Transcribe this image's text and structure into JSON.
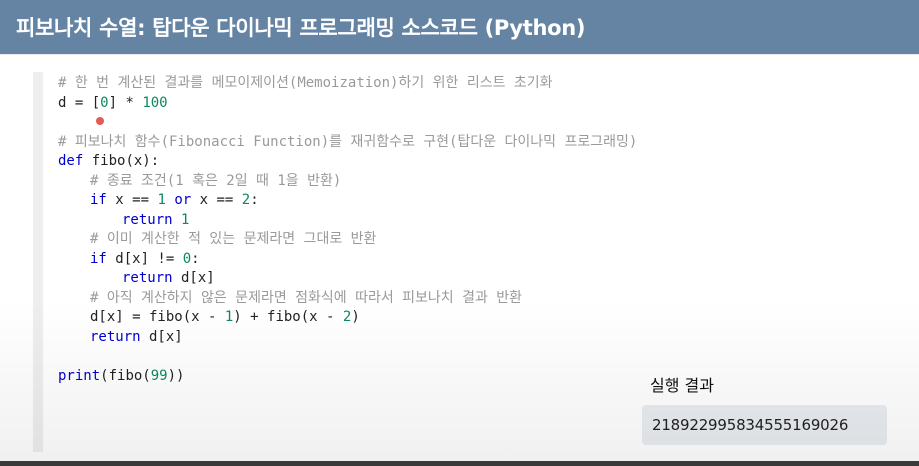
{
  "header": {
    "title": "피보나치 수열: 탑다운 다이나믹 프로그래밍 소스코드 (Python)",
    "background": "#6584a4"
  },
  "code": {
    "line1_comment": "# 한 번 계산된 결과를 메모이제이션(Memoization)하기 위한 리스트 초기화",
    "line2_a": "d = [",
    "line2_num0": "0",
    "line2_b": "] * ",
    "line2_num100": "100",
    "line4_comment": "# 피보나치 함수(Fibonacci Function)를 재귀함수로 구현(탑다운 다이나믹 프로그래밍)",
    "line5_kw": "def",
    "line5_rest": " fibo(x):",
    "line6_comment": "# 종료 조건(1 혹은 2일 때 1을 반환)",
    "line7_if": "if",
    "line7_a": " x == ",
    "line7_num1": "1",
    "line7_or": "or",
    "line7_b": " x == ",
    "line7_num2": "2",
    "line7_c": ":",
    "line8_return": "return",
    "line8_num": "1",
    "line9_comment": "# 이미 계산한 적 있는 문제라면 그대로 반환",
    "line10_if": "if",
    "line10_a": " d[x] != ",
    "line10_num": "0",
    "line10_b": ":",
    "line11_return": "return",
    "line11_rest": " d[x]",
    "line12_comment": "# 아직 계산하지 않은 문제라면 점화식에 따라서 피보나치 결과 반환",
    "line13_a": "d[x] = fibo(x - ",
    "line13_num1": "1",
    "line13_b": ") + fibo(x - ",
    "line13_num2": "2",
    "line13_c": ")",
    "line14_return": "return",
    "line14_rest": " d[x]",
    "line16_kw": "print",
    "line16_a": "(fibo(",
    "line16_num": "99",
    "line16_b": "))"
  },
  "result": {
    "label": "실행 결과",
    "value": "218922995834555169026"
  },
  "colors": {
    "keyword": "#0000cc",
    "number": "#0a8a5c",
    "comment": "#9a9a9a"
  }
}
